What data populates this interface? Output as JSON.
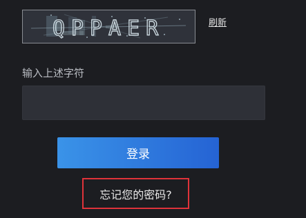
{
  "captcha": {
    "text": "QPPAER",
    "refresh_label": "刷新"
  },
  "input": {
    "label": "输入上述字符",
    "value": "",
    "placeholder": ""
  },
  "login_button": {
    "label": "登录"
  },
  "forgot_password": {
    "label": "忘记您的密码?"
  },
  "colors": {
    "background": "#1c1d21",
    "button_start": "#3a93e8",
    "button_end": "#2563d4",
    "highlight_border": "#e0333a"
  }
}
